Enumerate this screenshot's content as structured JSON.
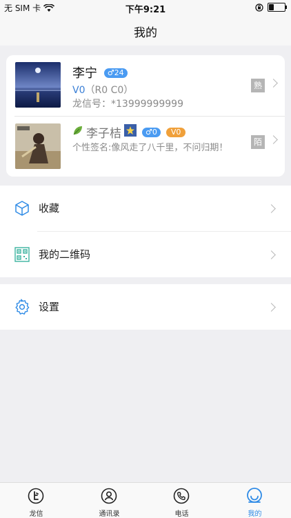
{
  "status_bar": {
    "carrier": "无 SIM 卡",
    "time": "下午9:21",
    "battery_percent": 35
  },
  "nav": {
    "title": "我的"
  },
  "profile": {
    "name": "李宁",
    "gender_age": "♂24",
    "level_name": "V0",
    "level_detail": "（R0 C0）",
    "id_label": "龙信号：",
    "id_value": "*13999999999",
    "relation_tag": "熟"
  },
  "contact": {
    "name": "李子桔",
    "gender_age": "♂0",
    "level": "V0",
    "signature": "个性签名:像风走了八千里，不问归期！",
    "relation_tag": "陌"
  },
  "menu": {
    "favorites": "收藏",
    "qr_code": "我的二维码",
    "settings": "设置"
  },
  "tabs": [
    {
      "label": "龙信",
      "icon": "longxin-icon"
    },
    {
      "label": "通讯录",
      "icon": "contacts-icon"
    },
    {
      "label": "电话",
      "icon": "phone-icon"
    },
    {
      "label": "我的",
      "icon": "profile-icon"
    }
  ],
  "colors": {
    "accent": "#2f8be6",
    "gender_badge": "#4a9bf2",
    "level_badge": "#f0a03a",
    "background": "#efeff2"
  }
}
